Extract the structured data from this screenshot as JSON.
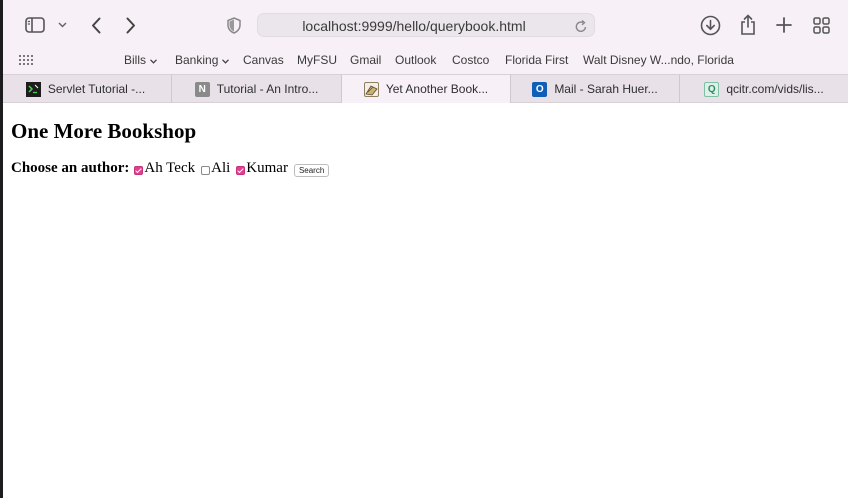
{
  "toolbar": {
    "url": "localhost:9999/hello/querybook.html",
    "icons": [
      "sidebar-icon",
      "chevron-down-icon",
      "back-icon",
      "forward-icon",
      "shield-icon",
      "reload-icon",
      "download-icon",
      "share-icon",
      "plus-icon",
      "tab-overview-icon"
    ]
  },
  "favorites": [
    {
      "label": "Bills",
      "dropdown": true
    },
    {
      "label": "Banking",
      "dropdown": true
    },
    {
      "label": "Canvas"
    },
    {
      "label": "MyFSU"
    },
    {
      "label": "Gmail"
    },
    {
      "label": "Outlook"
    },
    {
      "label": "Costco"
    },
    {
      "label": "Florida First"
    },
    {
      "label": "Walt Disney W...ndo, Florida"
    }
  ],
  "tabs": [
    {
      "title": "Servlet Tutorial -...",
      "active": false
    },
    {
      "title": "Tutorial - An Intro...",
      "active": false
    },
    {
      "title": "Yet Another Book...",
      "active": true
    },
    {
      "title": "Mail - Sarah Huer...",
      "active": false
    },
    {
      "title": "qcitr.com/vids/lis...",
      "active": false
    }
  ],
  "page": {
    "heading": "One More Bookshop",
    "prompt": "Choose an author:",
    "authors": [
      {
        "label": "Ah Teck",
        "checked": true
      },
      {
        "label": "Ali",
        "checked": false
      },
      {
        "label": "Kumar",
        "checked": true
      }
    ],
    "search_label": "Search"
  },
  "colors": {
    "toolbar_bg": "#f7f1f7",
    "tabstrip_bg": "#e8e2e8",
    "checkbox_accent": "#e0408f"
  }
}
